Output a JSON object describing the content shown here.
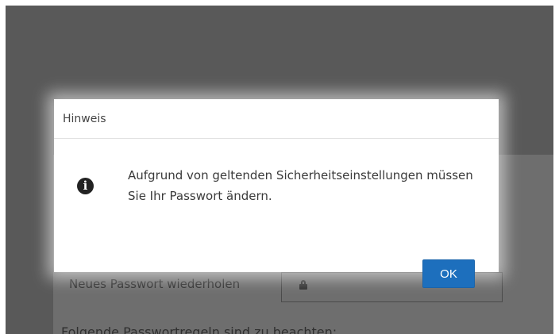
{
  "background_page": {
    "repeat_password_label": "Neues Passwort wiederholen",
    "rules_heading": "Folgende Passwortregeln sind zu beachten:"
  },
  "dialog": {
    "title": "Hinweis",
    "icon": "info-icon",
    "message": "Aufgrund von geltenden Sicherheitseinstellungen müssen Sie Ihr Passwort ändern.",
    "ok_label": "OK"
  },
  "colors": {
    "overlay": "#595959",
    "button": "#1d6fbd"
  }
}
